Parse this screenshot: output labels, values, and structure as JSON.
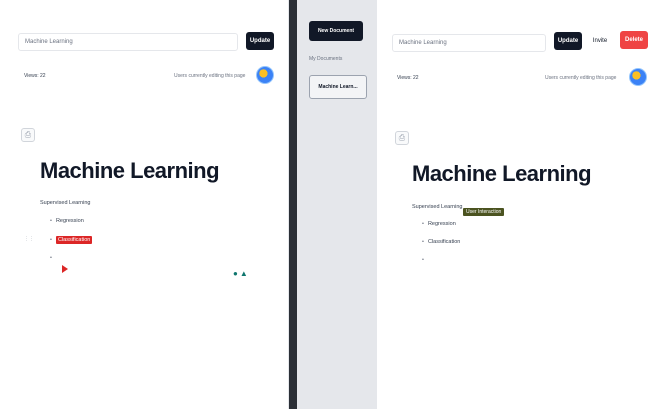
{
  "left": {
    "title_value": "Machine Learning",
    "update_label": "Update",
    "views_text": "Views: 22",
    "editing_text": "Users currently editing this page",
    "doc_title": "Machine Learning",
    "lines": {
      "heading": "Supervised Learning",
      "item1": "Regression",
      "item2": "Classification"
    }
  },
  "middle": {
    "new_document_label": "New Document",
    "my_documents_label": "My Documents",
    "doc_item_label": "Machine Learn..."
  },
  "right": {
    "title_value": "Machine Learning",
    "update_label": "Update",
    "invite_label": "Invite",
    "delete_label": "Delete",
    "views_text": "Views: 22",
    "editing_text": "Users currently editing this page",
    "doc_title": "Machine Learning",
    "lines": {
      "heading": "Supervised Learning",
      "tag": "User Interaction",
      "item1": "Regression",
      "item2": "Classification"
    }
  },
  "colors": {
    "dark": "#111827",
    "red": "#dc2626",
    "olive": "#4b5320",
    "divider": "#2b2f36"
  }
}
